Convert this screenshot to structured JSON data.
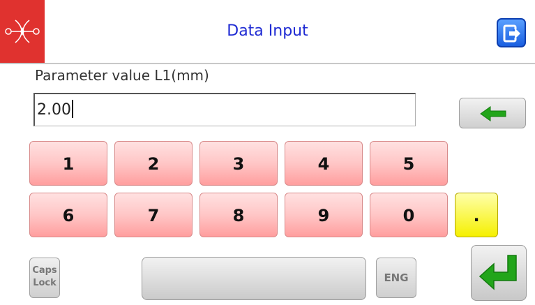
{
  "header": {
    "title": "Data Input",
    "logo_icon": "brand-logo-icon",
    "exit_icon": "exit-icon"
  },
  "input": {
    "label": "Parameter value L1(mm)",
    "value": "2.00"
  },
  "keypad": {
    "row1": [
      "1",
      "2",
      "3",
      "4",
      "5"
    ],
    "row2": [
      "6",
      "7",
      "8",
      "9",
      "0",
      "."
    ],
    "caps_line1": "Caps",
    "caps_line2": "Lock",
    "lang_label": "ENG"
  },
  "colors": {
    "brand_red": "#e0322f",
    "title_blue": "#1f2bd3",
    "key_pink": "#ffc6c6",
    "key_yellow": "#f5f000",
    "arrow_green": "#22a51a"
  }
}
